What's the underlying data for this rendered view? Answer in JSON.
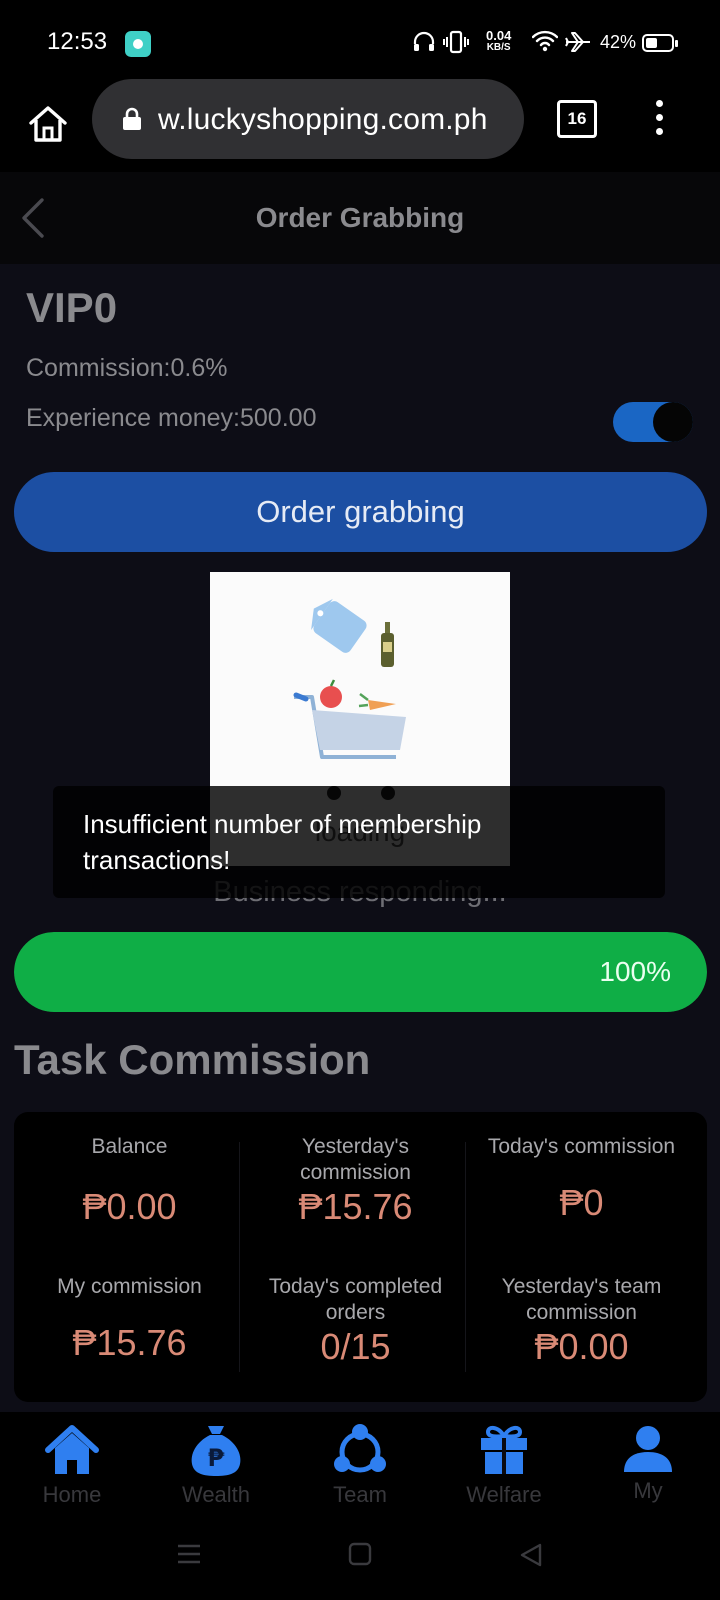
{
  "status_bar": {
    "time": "12:53",
    "net_speed_value": "0.04",
    "net_speed_unit": "KB/S",
    "battery": "42%"
  },
  "browser": {
    "url": "w.luckyshopping.com.ph",
    "tab_count": "16"
  },
  "header": {
    "title": "Order Grabbing"
  },
  "vip": {
    "level": "VIP0",
    "commission": "Commission:0.6%",
    "experience": "Experience money:500.00",
    "toggle_on": true
  },
  "grab_button": "Order grabbing",
  "loading": {
    "label": "loading",
    "status": "Business responding...",
    "toast": "Insufficient number of membership transactions!"
  },
  "progress": {
    "value": 1.0,
    "label": "100%"
  },
  "task": {
    "title": "Task Commission",
    "stats": [
      {
        "label": "Balance",
        "value": "₱0.00"
      },
      {
        "label": "Yesterday's commission",
        "value": "₱15.76"
      },
      {
        "label": "Today's commission",
        "value": "₱0"
      },
      {
        "label": "My commission",
        "value": "₱15.76"
      },
      {
        "label": "Today's completed orders",
        "value": "0/15"
      },
      {
        "label": "Yesterday's team commission",
        "value": "₱0.00"
      }
    ]
  },
  "nav": {
    "items": [
      {
        "label": "Home",
        "icon": "home-icon"
      },
      {
        "label": "Wealth",
        "icon": "money-bag-icon"
      },
      {
        "label": "Team",
        "icon": "team-icon"
      },
      {
        "label": "Welfare",
        "icon": "gift-icon"
      },
      {
        "label": "My",
        "icon": "user-icon"
      }
    ]
  },
  "colors": {
    "accent_blue": "#1c4fa3",
    "progress_green": "#0fae46",
    "value_salmon": "#d98a76",
    "nav_icon_blue": "#2f7ff0"
  }
}
